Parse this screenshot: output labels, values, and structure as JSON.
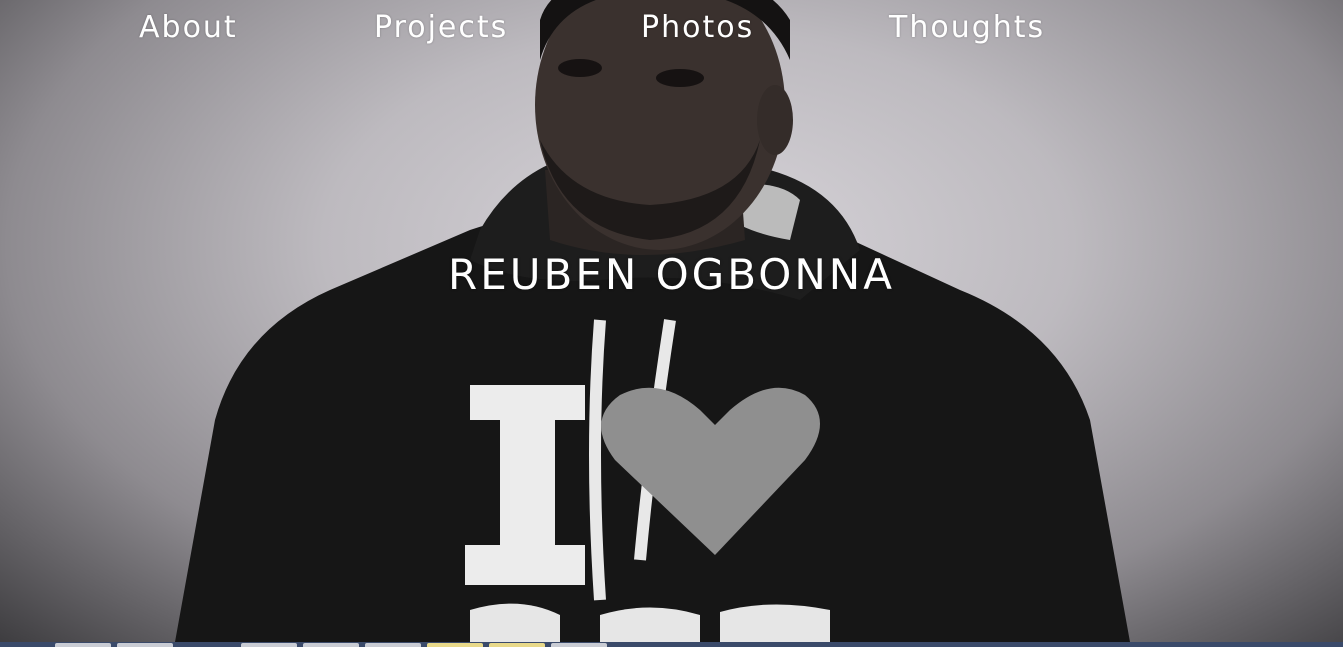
{
  "nav": {
    "about": "About",
    "projects": "Projects",
    "photos": "Photos",
    "thoughts": "Thoughts"
  },
  "hero": {
    "title": "REUBEN OGBONNA"
  },
  "colors": {
    "text": "#ffffff",
    "background_light": "#d7d4d9",
    "background_dark": "#3e3d40",
    "taskbar": "#3a4a6a"
  }
}
